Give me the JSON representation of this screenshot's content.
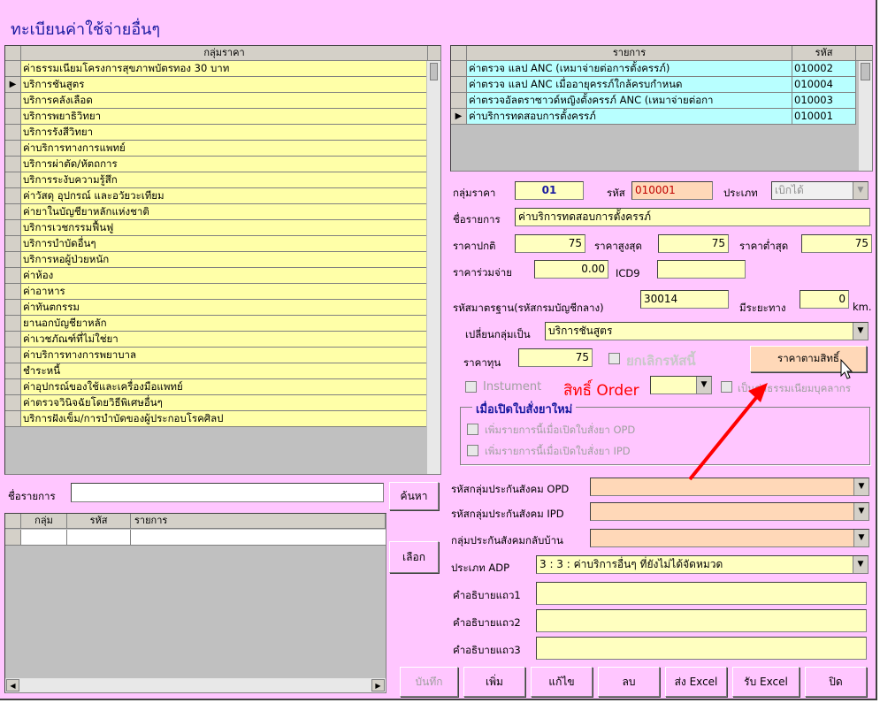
{
  "window": {
    "title": "ทะเบียนค่าใช้จ่ายอื่นๆ"
  },
  "left_grid": {
    "header": "กลุ่มราคา",
    "current_index": 1,
    "rows": [
      "ค่าธรรมเนียมโครงการสุขภาพบัตรทอง 30 บาท",
      "บริการชันสูตร",
      "บริการคลังเลือด",
      "บริการพยาธิวิทยา",
      "บริการรังสีวิทยา",
      "ค่าบริการทางการแพทย์",
      "บริการผ่าตัด/หัตถการ",
      "บริการระงับความรู้สึก",
      "ค่าวัสดุ อุปกรณ์ และอวัยวะเทียม",
      "ค่ายาในบัญชียาหลักแห่งชาติ",
      "บริการเวชกรรมฟื้นฟู",
      "บริการบำบัดอื่นๆ",
      "บริการหอผู้ป่วยหนัก",
      "ค่าห้อง",
      "ค่าอาหาร",
      "ค่าทันตกรรม",
      "ยานอกบัญชียาหลัก",
      "ค่าเวชภัณฑ์ที่ไม่ใช่ยา",
      "ค่าบริการทางการพยาบาล",
      "ชำระหนี้",
      "ค่าอุปกรณ์ของใช้และเครื่องมือแพทย์",
      "ค่าตรวจวินิจฉัยโดยวิธีพิเศษอื่นๆ",
      "บริการฝังเข็ม/การบำบัดของผู้ประกอบโรคศิลป"
    ]
  },
  "right_grid": {
    "headers": [
      "รายการ",
      "รหัส"
    ],
    "current_index": 3,
    "rows": [
      [
        "ค่าตรวจ แลป ANC (เหมาจ่ายต่อการตั้งครรภ์)",
        "010002"
      ],
      [
        "ค่าตรวจ แลป ANC เมื่ออายุครรภ์ใกล้ครบกำหนด",
        "010004"
      ],
      [
        "ค่าตรวจอัลตราซาวด์หญิงตั้งครรภ์ ANC (เหมาจ่ายต่อกา",
        "010003"
      ],
      [
        "ค่าบริการทดสอบการตั้งครรภ์",
        "010001"
      ]
    ]
  },
  "form": {
    "group_label": "กลุ่มราคา",
    "group_value": "01",
    "code_label": "รหัส",
    "code_value": "010001",
    "type_label": "ประเภท",
    "type_value": "เบิกได้",
    "item_name_label": "ชื่อรายการ",
    "item_name_value": "ค่าบริการทดสอบการตั้งครรภ์",
    "normal_price_label": "ราคาปกติ",
    "normal_price": "75",
    "max_price_label": "ราคาสูงสุด",
    "max_price": "75",
    "min_price_label": "ราคาต่ำสุด",
    "min_price": "75",
    "copay_label": "ราคาร่วมจ่าย",
    "copay": "0.00",
    "icd9_label": "ICD9",
    "icd9": "",
    "std_code_label": "รหัสมาตรฐาน(รหัสกรมบัญชีกลาง)",
    "std_code": "30014",
    "distance_label": "มีระยะทาง",
    "distance": "0",
    "distance_unit": "km.",
    "change_group_label": "เปลี่ยนกลุ่มเป็น",
    "change_group_value": "บริการชันสูตร",
    "cost_label": "ราคาทุน",
    "cost": "75",
    "cancel_code_label": "ยกเลิกรหัสนี้",
    "price_by_right_button": "ราคาตามสิทธิ์",
    "instrument_label": "Instument",
    "right_order_label": "สิทธิ์ Order",
    "staff_fee_label": "เป็นค่าธรรมเนียมบุคลากร",
    "open_order_group": "เมื่อเปิดใบสั่งยาใหม่",
    "add_opd_label": "เพิ่มรายการนี้เมื่อเปิดใบสั่งยา OPD",
    "add_ipd_label": "เพิ่มรายการนี้เมื่อเปิดใบสั่งยา IPD",
    "sso_opd_label": "รหัสกลุ่มประกันสังคม OPD",
    "sso_ipd_label": "รหัสกลุ่มประกันสังคม IPD",
    "sso_home_label": "กลุ่มประกันสังคมกลับบ้าน",
    "adp_label": "ประเภท ADP",
    "adp_value": "3 : 3 : ค่าบริการอื่นๆ ที่ยังไม่ได้จัดหมวด",
    "desc1_label": "คำอธิบายแถว1",
    "desc2_label": "คำอธิบายแถว2",
    "desc3_label": "คำอธิบายแถว3"
  },
  "search": {
    "name_label": "ชื่อรายการ",
    "search_button": "ค้นหา",
    "select_button": "เลือก",
    "headers": [
      "กลุ่ม",
      "รหัส",
      "รายการ"
    ]
  },
  "buttons": {
    "save": "บันทึก",
    "add": "เพิ่ม",
    "edit": "แก้ไข",
    "delete": "ลบ",
    "export_excel": "ส่ง Excel",
    "import_excel": "รับ Excel",
    "close": "ปิด"
  },
  "colors": {
    "window_bg": "#ffc6ff",
    "field_yellow": "#ffffc0",
    "field_peach": "#ffd8b8",
    "annotation_arrow": "#ff0000"
  }
}
